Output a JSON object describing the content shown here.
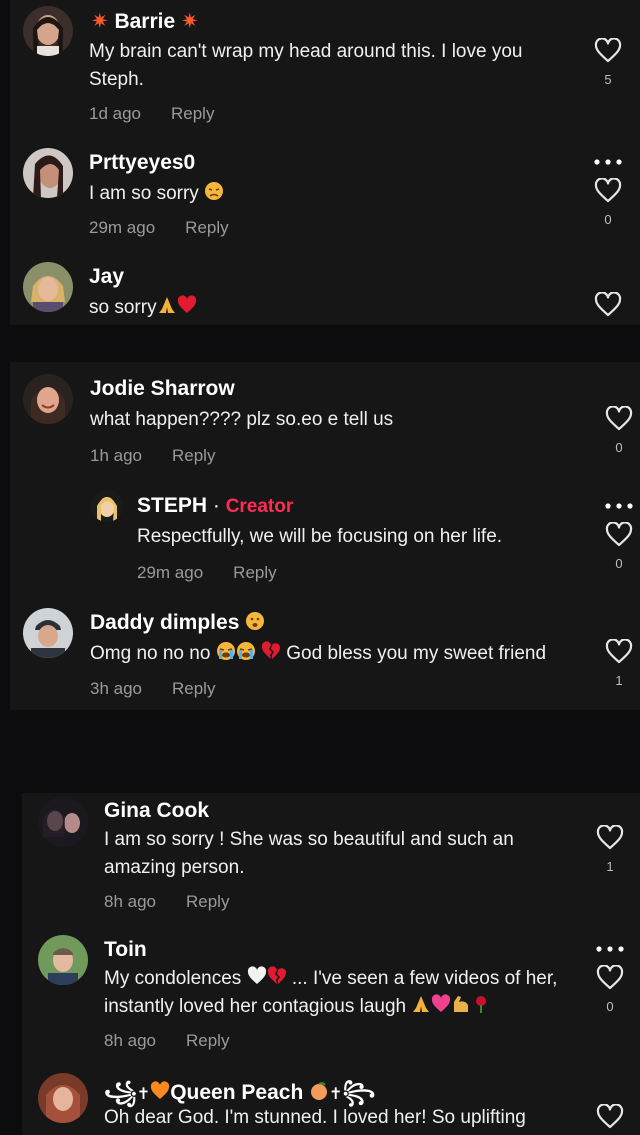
{
  "comments": [
    {
      "name": "Barrie",
      "text": "My brain can't wrap my head around this. I love you Steph.",
      "time": "1d ago",
      "reply": "Reply",
      "likes": "5"
    },
    {
      "name": "Prttyeyes0",
      "text": "I am so sorry",
      "time": "29m ago",
      "reply": "Reply",
      "likes": "0"
    },
    {
      "name": "Jay",
      "text": "so sorry"
    },
    {
      "name": "Jodie Sharrow",
      "text": "what happen???? plz so.eo e tell us",
      "time": "1h ago",
      "reply": "Reply",
      "likes": "0"
    },
    {
      "name": "STEPH",
      "badge": "Creator",
      "text": "Respectfully, we will be focusing on her life.",
      "time": "29m ago",
      "reply": "Reply",
      "likes": "0"
    },
    {
      "name": "Daddy dimples",
      "text_a": "Omg no no no",
      "text_b": "God bless you my sweet friend",
      "time": "3h ago",
      "reply": "Reply",
      "likes": "1"
    },
    {
      "name": "Gina Cook",
      "text": "I am so sorry ! She was so beautiful and such an amazing person.",
      "time": "8h ago",
      "reply": "Reply",
      "likes": "1"
    },
    {
      "name": "Toin",
      "text_a": "My condolences",
      "text_b": "... I've seen a few videos of her,",
      "text_c": "instantly loved her contagious laugh",
      "time": "8h ago",
      "reply": "Reply",
      "likes": "0"
    },
    {
      "name": "Queen Peach",
      "text": "Oh dear God. I'm stunned. I loved her! So uplifting"
    }
  ],
  "colors": {
    "background": "#0c0c0e",
    "panel": "#161616",
    "creator_badge": "#fe2c55",
    "meta_text": "#9a9a9a"
  },
  "icons": [
    "heart-outline-icon",
    "more-dots-icon"
  ]
}
